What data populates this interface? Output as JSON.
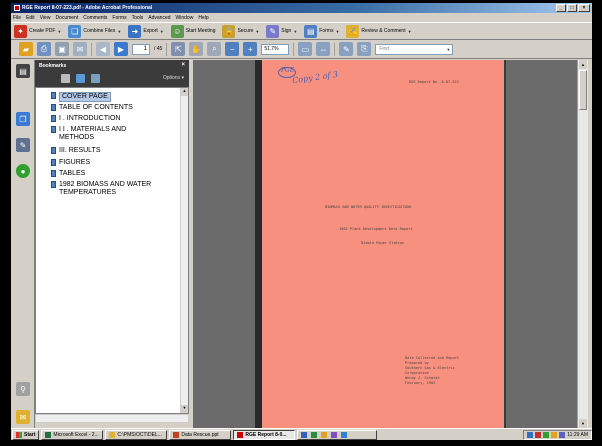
{
  "window": {
    "title": "RGE Report 8-07-223.pdf - Adobe Acrobat Professional",
    "buttons": [
      "_",
      "□",
      "×"
    ]
  },
  "menu": [
    "File",
    "Edit",
    "View",
    "Document",
    "Comments",
    "Forms",
    "Tools",
    "Advanced",
    "Window",
    "Help"
  ],
  "toolbar": {
    "create_pdf": "Create PDF",
    "combine_files": "Combine Files",
    "export": "Export",
    "start_meeting": "Start Meeting",
    "secure": "Secure",
    "sign": "Sign",
    "forms": "Forms",
    "review_comment": "Review & Comment"
  },
  "nav": {
    "page_current": "1",
    "page_total": "/ 45",
    "zoom": "51.7%",
    "find_placeholder": "Find"
  },
  "bookmarks": {
    "title": "Bookmarks",
    "options": "Options",
    "close": "×",
    "items": [
      {
        "label": "COVER PAGE",
        "selected": true
      },
      {
        "label": "TABLE OF CONTENTS"
      },
      {
        "label": "I . INTRODUCTION"
      },
      {
        "label": "I I . MATERIALS AND\nMETHODS"
      },
      {
        "label": "III. RESULTS"
      },
      {
        "label": "FIGURES"
      },
      {
        "label": "TABLES"
      },
      {
        "label": "1982 BIOMASS AND WATER\nTEMPERATURES"
      }
    ]
  },
  "document": {
    "handwriting_1": "PGE",
    "handwriting_2": "Copy 2 of 3",
    "report_no": "RGE Report No. 8-07-223",
    "title_line1": "BIOMASS AND WATER QUALITY INVESTIGATIONS",
    "title_line2": "1982 Plant Development Data Report",
    "title_line3": "Diablo Power Station",
    "footer": "Data Collected and Report\nPrepared by\nSouthern Gas & Electric\nCorporation\nWendy J. Schmidt\nFebruary, 1983"
  },
  "taskbar": {
    "start": "Start",
    "tasks": [
      {
        "label": "Microsoft Excel - 2..."
      },
      {
        "label": "C:\\PMS\\OCT\\DEL..."
      },
      {
        "label": "Data Rescue.ppt"
      },
      {
        "label": "RGE Report 8-0...",
        "active": true
      }
    ],
    "clock": "11:29 AM"
  }
}
